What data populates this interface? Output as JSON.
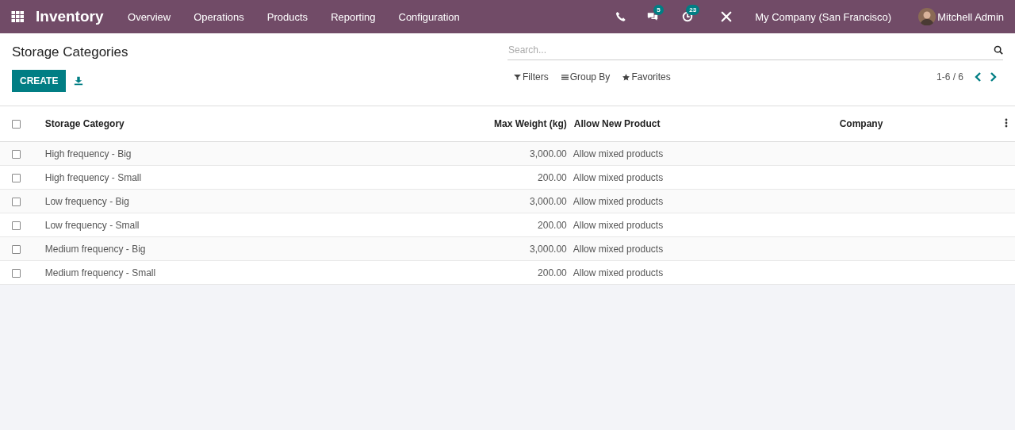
{
  "navbar": {
    "app_name": "Inventory",
    "menu": [
      "Overview",
      "Operations",
      "Products",
      "Reporting",
      "Configuration"
    ],
    "messages_badge": "5",
    "activities_badge": "23",
    "company": "My Company (San Francisco)",
    "user": "Mitchell Admin"
  },
  "control_panel": {
    "title": "Storage Categories",
    "create_label": "CREATE",
    "search": {
      "placeholder": "Search..."
    },
    "filters": [
      "Filters",
      "Group By",
      "Favorites"
    ],
    "pager": "1-6 / 6"
  },
  "table": {
    "columns": [
      "Storage Category",
      "Max Weight (kg)",
      "Allow New Product",
      "Company"
    ],
    "all_checked": false,
    "rows": [
      {
        "name": "High frequency - Big",
        "max_weight": "3,000.00",
        "allow": "Allow mixed products",
        "checked": false
      },
      {
        "name": "High frequency - Small",
        "max_weight": "200.00",
        "allow": "Allow mixed products",
        "checked": false
      },
      {
        "name": "Low frequency - Big",
        "max_weight": "3,000.00",
        "allow": "Allow mixed products",
        "checked": false
      },
      {
        "name": "Low frequency - Small",
        "max_weight": "200.00",
        "allow": "Allow mixed products",
        "checked": false
      },
      {
        "name": "Medium frequency - Big",
        "max_weight": "3,000.00",
        "allow": "Allow mixed products",
        "checked": false
      },
      {
        "name": "Medium frequency - Small",
        "max_weight": "200.00",
        "allow": "Allow mixed products",
        "checked": false
      }
    ]
  }
}
